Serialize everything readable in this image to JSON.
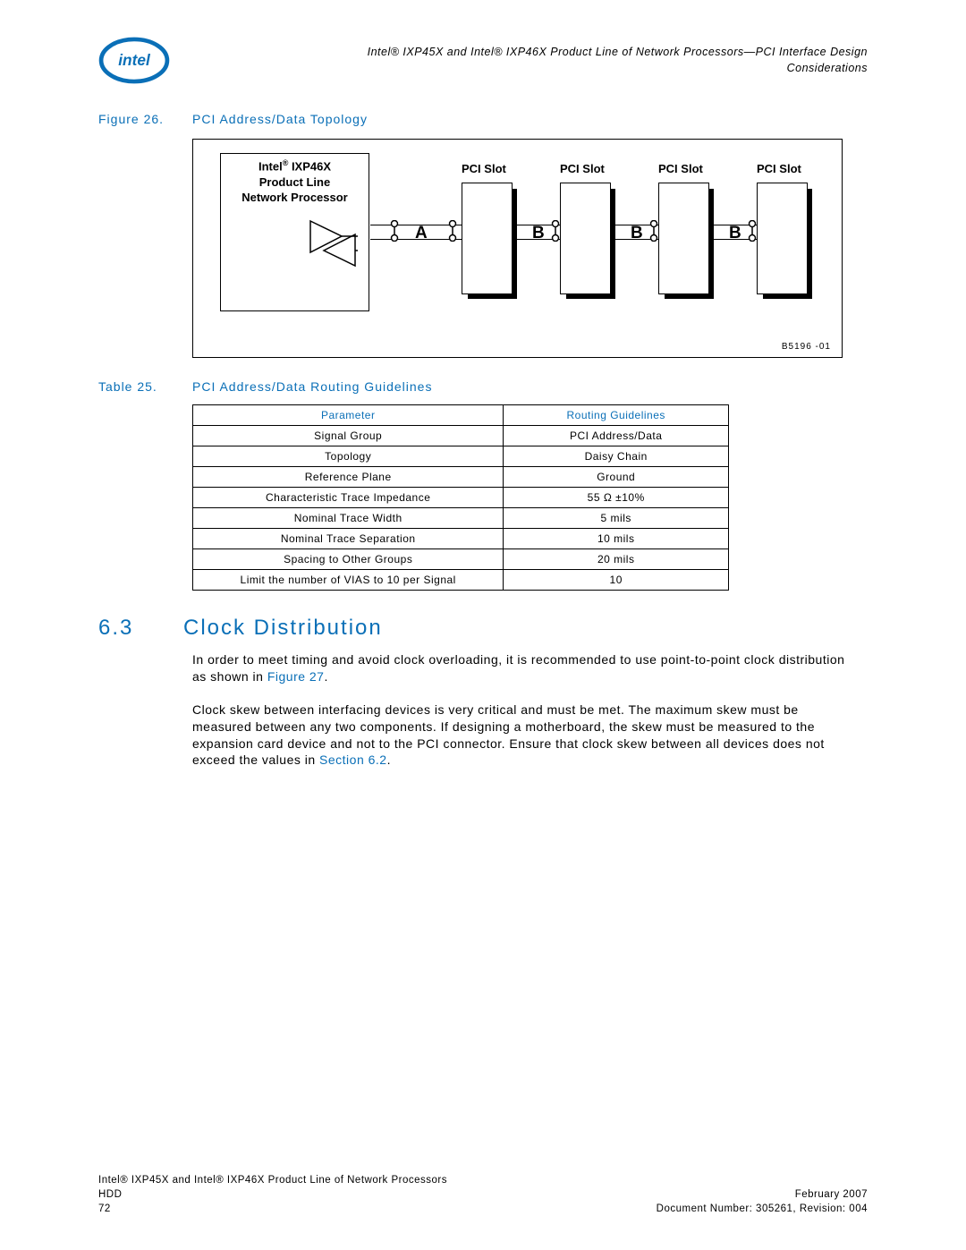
{
  "header": {
    "line1": "Intel® IXP45X and Intel® IXP46X Product Line of Network Processors—PCI Interface Design",
    "line2": "Considerations"
  },
  "figure26": {
    "label": "Figure 26.",
    "title": "PCI Address/Data Topology",
    "processor_line1": "Intel",
    "processor_sup": "®",
    "processor_line1b": " IXP46X",
    "processor_line2": "Product Line",
    "processor_line3": "Network Processor",
    "slot_label": "PCI Slot",
    "seg_a": "A",
    "seg_b": "B",
    "ref": "B5196 -01"
  },
  "table25": {
    "label": "Table 25.",
    "title": "PCI Address/Data Routing Guidelines",
    "headers": {
      "param": "Parameter",
      "guide": "Routing Guidelines"
    },
    "rows": [
      {
        "p": "Signal Group",
        "g": "PCI Address/Data"
      },
      {
        "p": "Topology",
        "g": "Daisy Chain"
      },
      {
        "p": "Reference Plane",
        "g": "Ground"
      },
      {
        "p": "Characteristic Trace Impedance",
        "g": "55 Ω ±10%"
      },
      {
        "p": "Nominal Trace Width",
        "g": "5 mils"
      },
      {
        "p": "Nominal Trace Separation",
        "g": "10 mils"
      },
      {
        "p": "Spacing to Other Groups",
        "g": "20 mils"
      },
      {
        "p": "Limit the number of VIAS to 10 per Signal",
        "g": "10"
      }
    ]
  },
  "section63": {
    "num": "6.3",
    "title": "Clock Distribution",
    "para1_a": "In order to meet timing and avoid clock overloading, it is recommended to use point-to-point clock distribution as shown in ",
    "para1_link": "Figure 27",
    "para1_b": ".",
    "para2_a": "Clock skew between interfacing devices is very critical and must be met. The maximum skew must be measured between any two components. If designing a motherboard, the skew must be measured to the expansion card device and not to the PCI connector. Ensure that clock skew between all devices does not exceed the values in ",
    "para2_link": "Section 6.2",
    "para2_b": "."
  },
  "footer": {
    "left1": "Intel® IXP45X and Intel® IXP46X Product Line of Network Processors",
    "left2": "HDD",
    "left3": "72",
    "right1": "February 2007",
    "right2": "Document Number: 305261, Revision: 004"
  }
}
